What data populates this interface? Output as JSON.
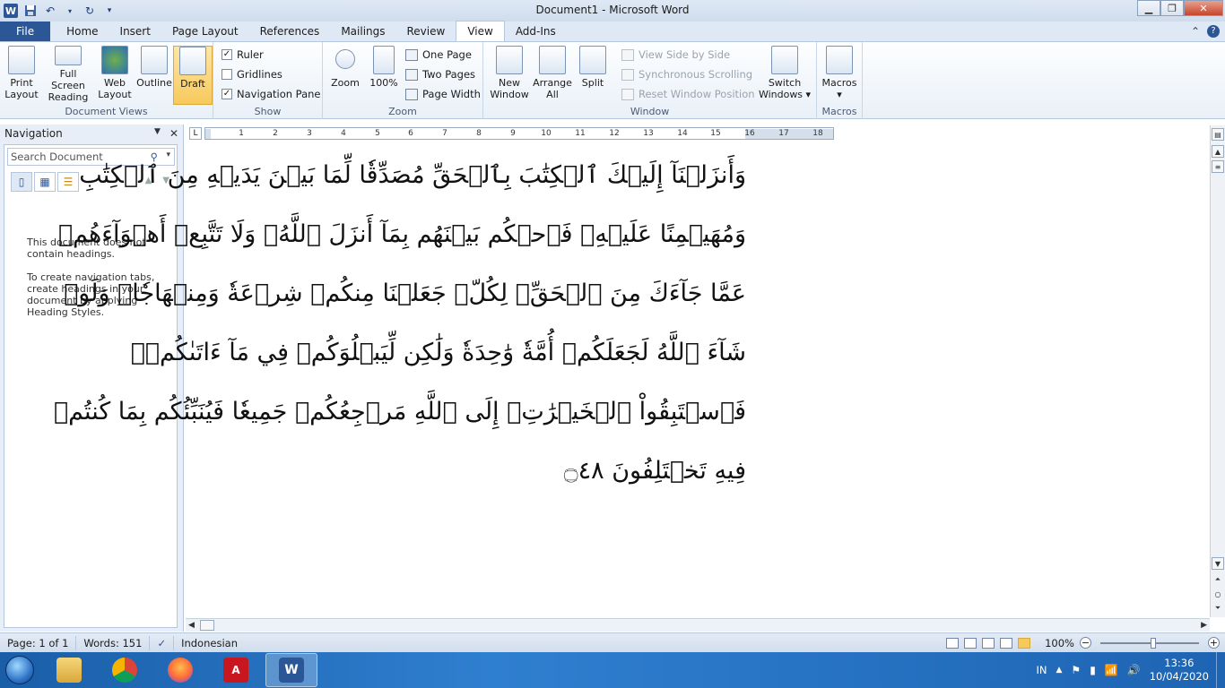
{
  "window": {
    "title": "Document1  -  Microsoft Word"
  },
  "qat": {
    "logo": "W",
    "icons": [
      "save-icon",
      "undo-icon",
      "redo-icon",
      "customize-icon"
    ]
  },
  "tabs": [
    {
      "label": "File"
    },
    {
      "label": "Home"
    },
    {
      "label": "Insert"
    },
    {
      "label": "Page Layout"
    },
    {
      "label": "References"
    },
    {
      "label": "Mailings"
    },
    {
      "label": "Review"
    },
    {
      "label": "View"
    },
    {
      "label": "Add-Ins"
    }
  ],
  "ribbon": {
    "document_views": {
      "label": "Document Views",
      "buttons": [
        {
          "label": "Print\nLayout"
        },
        {
          "label": "Full Screen\nReading"
        },
        {
          "label": "Web\nLayout"
        },
        {
          "label": "Outline"
        },
        {
          "label": "Draft"
        }
      ]
    },
    "show": {
      "label": "Show",
      "ruler": "Ruler",
      "gridlines": "Gridlines",
      "navigation_pane": "Navigation Pane",
      "ruler_checked": true,
      "gridlines_checked": false,
      "navigation_pane_checked": true
    },
    "zoom": {
      "label": "Zoom",
      "zoom_button": "Zoom",
      "hundred_button": "100%",
      "one_page": "One Page",
      "two_pages": "Two Pages",
      "page_width": "Page Width"
    },
    "window": {
      "label": "Window",
      "new_window": "New\nWindow",
      "arrange_all": "Arrange\nAll",
      "split": "Split",
      "view_side_by_side": "View Side by Side",
      "sync_scrolling": "Synchronous Scrolling",
      "reset_window": "Reset Window Position",
      "switch_windows": "Switch\nWindows ▾"
    },
    "macros": {
      "label": "Macros",
      "button": "Macros\n▾"
    }
  },
  "navigation": {
    "title": "Navigation",
    "search_placeholder": "Search Document",
    "message1": "This document does not contain headings.",
    "message2": "To create navigation tabs, create headings in your document by applying Heading Styles."
  },
  "ruler": {
    "corner": "L",
    "numbers": [
      "1",
      "2",
      "3",
      "4",
      "5",
      "6",
      "7",
      "8",
      "9",
      "10",
      "11",
      "12",
      "13",
      "14",
      "15",
      "16",
      "17",
      "18"
    ]
  },
  "document": {
    "lines": [
      "وَأَنزَلۡنَآ إِلَيۡكَ ٱلۡكِتَٰبَ بِٱلۡحَقِّ مُصَدِّقٗا لِّمَا بَيۡنَ يَدَيۡهِ مِنَ ٱلۡكِتَٰبِ",
      "وَمُهَيۡمِنًا عَلَيۡهِۖ فَٱحۡكُم بَيۡنَهُم بِمَآ أَنزَلَ ٱللَّهُۖ وَلَا تَتَّبِعۡ أَهۡوَآءَهُمۡ",
      "عَمَّا جَآءَكَ مِنَ ٱلۡحَقِّۚ لِكُلّٖ جَعَلۡنَا مِنكُمۡ شِرۡعَةٗ وَمِنۡهَاجٗاۚ وَلَوۡ",
      "شَآءَ ٱللَّهُ لَجَعَلَكُمۡ أُمَّةٗ وَٰحِدَةٗ وَلَٰكِن لِّيَبۡلُوَكُمۡ فِي مَآ ءَاتَىٰكُمۡۖ",
      "فَٱسۡتَبِقُواْ ٱلۡخَيۡرَٰتِۚ إِلَى ٱللَّهِ مَرۡجِعُكُمۡ جَمِيعٗا فَيُنَبِّئُكُم بِمَا كُنتُمۡ",
      "فِيهِ تَخۡتَلِفُونَ ۝٤٨"
    ]
  },
  "status": {
    "page": "Page: 1 of 1",
    "words": "Words: 151",
    "language": "Indonesian",
    "zoom": "100%"
  },
  "taskbar": {
    "apps": [
      "file-explorer-icon",
      "chrome-icon",
      "firefox-icon",
      "acrobat-icon",
      "word-icon"
    ],
    "lang": "IN",
    "time": "13:36",
    "date": "10/04/2020"
  }
}
